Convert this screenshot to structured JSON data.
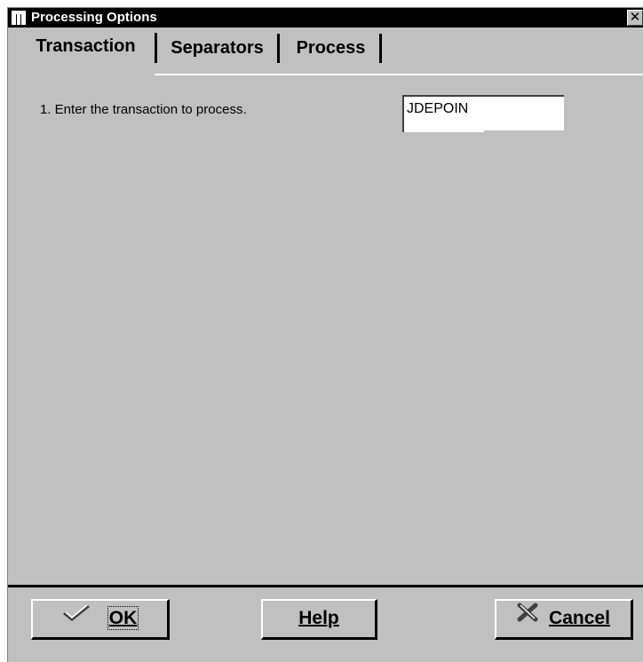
{
  "window": {
    "title": "Processing Options"
  },
  "tabs": [
    "Transaction",
    "Separators",
    "Process"
  ],
  "active_tab": "Transaction",
  "options": [
    {
      "label": "1. Enter the transaction to process.",
      "value": "JDEPOIN"
    }
  ],
  "buttons": {
    "ok": "OK",
    "help": "Help",
    "cancel": "Cancel"
  },
  "icons": {
    "ok": "checkmark-icon",
    "cancel": "x-icon",
    "close": "close-icon",
    "app": "form-icon"
  },
  "colors": {
    "titlebar": "#000000",
    "face": "#c0c0c0",
    "field": "#ffffff"
  }
}
